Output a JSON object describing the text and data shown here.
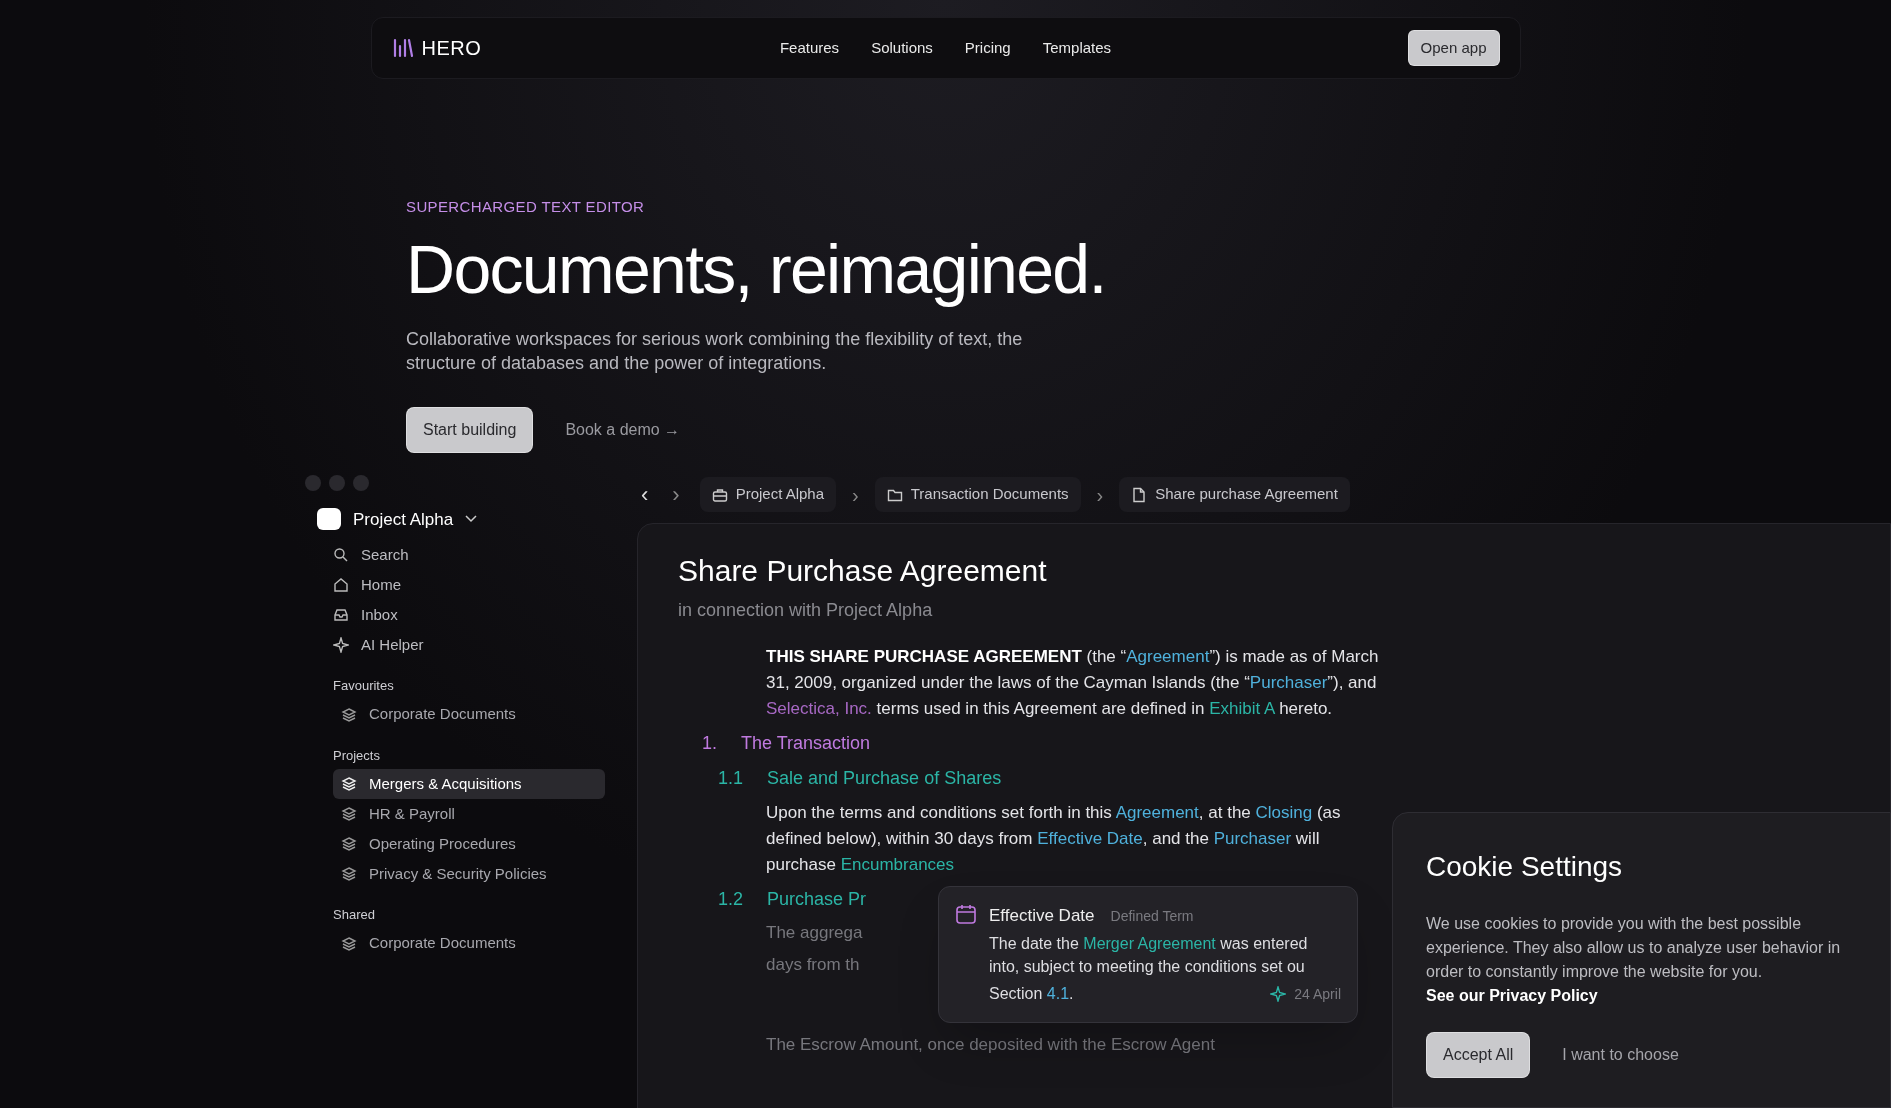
{
  "nav": {
    "logo": "HERO",
    "links": [
      "Features",
      "Solutions",
      "Pricing",
      "Templates"
    ],
    "cta": "Open app"
  },
  "hero": {
    "eyebrow": "SUPERCHARGED TEXT EDITOR",
    "title": "Documents, reimagined.",
    "subtitle": "Collaborative workspaces for serious work combining the flexibility of text, the structure of databases and the power of integrations.",
    "primary": "Start building",
    "secondary": "Book a demo →"
  },
  "app": {
    "workspace": "Project Alpha",
    "nav_items": [
      {
        "kind": "search",
        "label": "Search"
      },
      {
        "kind": "home",
        "label": "Home"
      },
      {
        "kind": "inbox",
        "label": "Inbox"
      },
      {
        "kind": "ai",
        "label": "AI Helper"
      }
    ],
    "sections": [
      {
        "title": "Favourites",
        "items": [
          {
            "label": "Corporate Documents",
            "selected": false
          }
        ]
      },
      {
        "title": "Projects",
        "items": [
          {
            "label": "Mergers & Acquisitions",
            "selected": true
          },
          {
            "label": "HR & Payroll",
            "selected": false
          },
          {
            "label": "Operating Procedures",
            "selected": false
          },
          {
            "label": "Privacy & Security Policies",
            "selected": false
          }
        ]
      },
      {
        "title": "Shared",
        "items": [
          {
            "label": "Corporate Documents",
            "selected": false
          }
        ]
      }
    ],
    "history": {
      "back": "‹",
      "forward": "›"
    },
    "separator": "›",
    "breadcrumbs": [
      {
        "kind": "project",
        "label": "Project Alpha"
      },
      {
        "kind": "folder",
        "label": "Transaction Documents"
      },
      {
        "kind": "file",
        "label": "Share purchase Agreement"
      }
    ],
    "document": {
      "title": "Share Purchase Agreement",
      "subtitle": "in connection with Project Alpha",
      "blocks": [
        {
          "kind": "para",
          "segments": [
            {
              "kind": "bold",
              "text": "THIS SHARE PURCHASE AGREEMENT"
            },
            {
              "kind": "plain",
              "text": " (the “"
            },
            {
              "kind": "term",
              "text": "Agreement"
            },
            {
              "kind": "plain",
              "text": "”) is made as of March 31, 2009, organized under the laws of the Cayman Islands (the “"
            },
            {
              "kind": "term",
              "text": "Purchaser"
            },
            {
              "kind": "plain",
              "text": "”), and "
            },
            {
              "kind": "entity",
              "text": "Selectica, Inc."
            },
            {
              "kind": "plain",
              "text": " terms used in this Agreement are defined in "
            },
            {
              "kind": "ref",
              "text": "Exhibit A"
            },
            {
              "kind": "plain",
              "text": " hereto."
            }
          ]
        },
        {
          "kind": "h1",
          "number": "1.",
          "text": "The Transaction"
        },
        {
          "kind": "h2",
          "number": "1.1",
          "text": "Sale and Purchase of Shares"
        },
        {
          "kind": "para",
          "segments": [
            {
              "kind": "plain",
              "text": "Upon the terms and conditions set forth in this "
            },
            {
              "kind": "term",
              "text": "Agreement"
            },
            {
              "kind": "plain",
              "text": ", at the "
            },
            {
              "kind": "term",
              "text": "Closing"
            },
            {
              "kind": "plain",
              "text": " (as defined below), within 30 days from "
            },
            {
              "kind": "term",
              "text": "Effective Date"
            },
            {
              "kind": "plain",
              "text": ", and the "
            },
            {
              "kind": "term",
              "text": "Purchaser"
            },
            {
              "kind": "plain",
              "text": " will purchase "
            },
            {
              "kind": "ref",
              "text": "Encumbrances"
            }
          ]
        },
        {
          "kind": "h2",
          "number": "1.2",
          "text": "Purchase Pr"
        },
        {
          "kind": "faded",
          "segments": [
            {
              "kind": "plain",
              "text": "The aggrega"
            }
          ]
        },
        {
          "kind": "faded",
          "segments": [
            {
              "kind": "plain",
              "text": "days from th"
            }
          ]
        },
        {
          "kind": "faded",
          "segments": [
            {
              "kind": "plain",
              "text": "The Escrow Amount, once deposited with the Escrow Agent"
            }
          ]
        }
      ]
    },
    "popover": {
      "title": "Effective Date",
      "tag": "Defined Term",
      "body": [
        {
          "kind": "plain",
          "text": "The date the "
        },
        {
          "kind": "ref",
          "text": "Merger Agreement"
        },
        {
          "kind": "plain",
          "text": " was entered into, subject to meeting the conditions set ou"
        }
      ],
      "body_end": [
        {
          "kind": "plain",
          "text": "Section "
        },
        {
          "kind": "term",
          "text": "4.1"
        },
        {
          "kind": "plain",
          "text": "."
        }
      ],
      "date": "24 April"
    }
  },
  "cookie": {
    "title": "Cookie Settings",
    "body": "We use cookies to provide you with the best possible experience. They also allow us to analyze user behavior in order to constantly improve the website for you.",
    "link": "See our Privacy Policy",
    "accept": "Accept All",
    "choose": "I want to choose"
  }
}
